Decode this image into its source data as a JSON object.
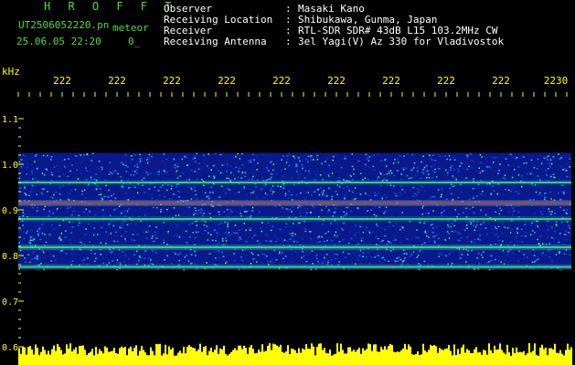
{
  "header": {
    "brand": "H R O F F T",
    "file_name": "UT2506052220.pn",
    "detector": "meteor",
    "timestamp": "25.06.05 22:20",
    "count": "0_",
    "info": [
      {
        "label": "Observer",
        "value": "Masaki Kano"
      },
      {
        "label": "Receiving Location",
        "value": "Shibukawa, Gunma, Japan"
      },
      {
        "label": "Receiver",
        "value": "RTL-SDR SDR# 43dB L15 103.2MHz CW"
      },
      {
        "label": "Receiving Antenna",
        "value": "3el Yagi(V) Az 330 for Vladivostok"
      }
    ],
    "separator": ":"
  },
  "chart_data": {
    "type": "heatmap",
    "ylabel": "kHz",
    "y_ticks": [
      "1.1",
      "1.0",
      "0.9",
      "0.8",
      "0.7",
      "0.6"
    ],
    "y_tick_values": [
      1.1,
      1.0,
      0.9,
      0.8,
      0.7,
      0.6
    ],
    "ylim": [
      0.6,
      1.15
    ],
    "x_tick_labels": [
      "222",
      "222",
      "222",
      "222",
      "222",
      "222",
      "222",
      "222",
      "222",
      "2230"
    ],
    "xlim": [
      "22:20",
      "22:30"
    ],
    "bands_khz": [
      {
        "freq": 0.915,
        "strength": 1.0
      },
      {
        "freq": 0.818,
        "strength": 0.75
      },
      {
        "freq": 0.775,
        "strength": 0.55
      },
      {
        "freq": 0.88,
        "strength": 0.45
      },
      {
        "freq": 0.96,
        "strength": 0.35
      }
    ],
    "colors": {
      "background": "#000000",
      "noise": "#1028b8",
      "band": "#ff2020",
      "ticks": "#ffff00",
      "signal_bar": "#ffff00"
    },
    "grid": false,
    "legend": "none"
  }
}
